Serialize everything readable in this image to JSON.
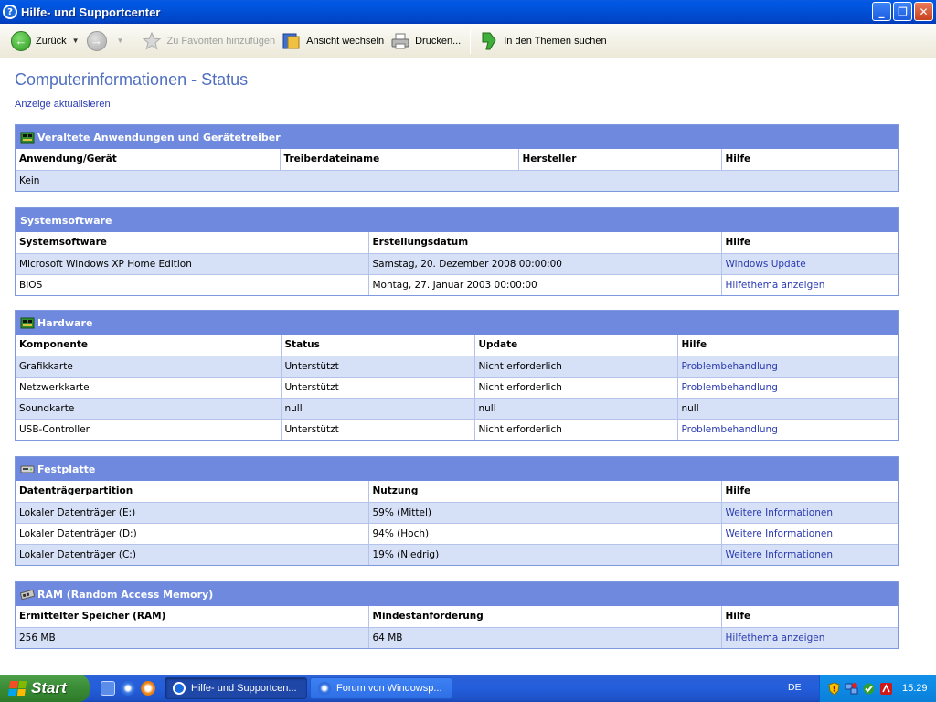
{
  "window": {
    "title": "Hilfe- und Supportcenter"
  },
  "toolbar": {
    "back_label": "Zurück",
    "favorites_label": "Zu Favoriten hinzufügen",
    "view_label": "Ansicht wechseln",
    "print_label": "Drucken...",
    "search_label": "In den Themen suchen"
  },
  "page": {
    "title": "Computerinformationen - Status",
    "refresh_link": "Anzeige aktualisieren"
  },
  "sections": {
    "outdated": {
      "title": "Veraltete Anwendungen und Gerätetreiber",
      "headers": [
        "Anwendung/Gerät",
        "Treiberdateiname",
        "Hersteller",
        "Hilfe"
      ],
      "rows": [
        [
          "Kein"
        ]
      ]
    },
    "system_software": {
      "title": "Systemsoftware",
      "headers": [
        "Systemsoftware",
        "Erstellungsdatum",
        "Hilfe"
      ],
      "rows": [
        [
          "Microsoft Windows XP Home Edition",
          "Samstag, 20. Dezember 2008 00:00:00",
          "Windows Update"
        ],
        [
          "BIOS",
          "Montag, 27. Januar 2003 00:00:00",
          "Hilfethema anzeigen"
        ]
      ]
    },
    "hardware": {
      "title": "Hardware",
      "headers": [
        "Komponente",
        "Status",
        "Update",
        "Hilfe"
      ],
      "rows": [
        [
          "Grafikkarte",
          "Unterstützt",
          "Nicht erforderlich",
          "Problembehandlung"
        ],
        [
          "Netzwerkkarte",
          "Unterstützt",
          "Nicht erforderlich",
          "Problembehandlung"
        ],
        [
          "Soundkarte",
          "null",
          "null",
          "null"
        ],
        [
          "USB-Controller",
          "Unterstützt",
          "Nicht erforderlich",
          "Problembehandlung"
        ]
      ]
    },
    "disk": {
      "title": "Festplatte",
      "headers": [
        "Datenträgerpartition",
        "Nutzung",
        "Hilfe"
      ],
      "rows": [
        [
          "Lokaler Datenträger (E:)",
          "59% (Mittel)",
          "Weitere Informationen"
        ],
        [
          "Lokaler Datenträger (D:)",
          "94% (Hoch)",
          "Weitere Informationen"
        ],
        [
          "Lokaler Datenträger (C:)",
          "19% (Niedrig)",
          "Weitere Informationen"
        ]
      ]
    },
    "ram": {
      "title": "RAM (Random Access Memory)",
      "headers": [
        "Ermittelter Speicher (RAM)",
        "Mindestanforderung",
        "Hilfe"
      ],
      "rows": [
        [
          "256 MB",
          "64 MB",
          "Hilfethema anzeigen"
        ]
      ]
    }
  },
  "taskbar": {
    "start_label": "Start",
    "tasks": [
      "Hilfe- und Supportcen...",
      "Forum von Windowsp..."
    ],
    "language": "DE",
    "clock": "15:29"
  },
  "colors": {
    "section_header": "#6e89dd",
    "row_shade": "#d6e0f6",
    "link": "#2a3bb0",
    "title_blue": "#4f6fbf"
  }
}
